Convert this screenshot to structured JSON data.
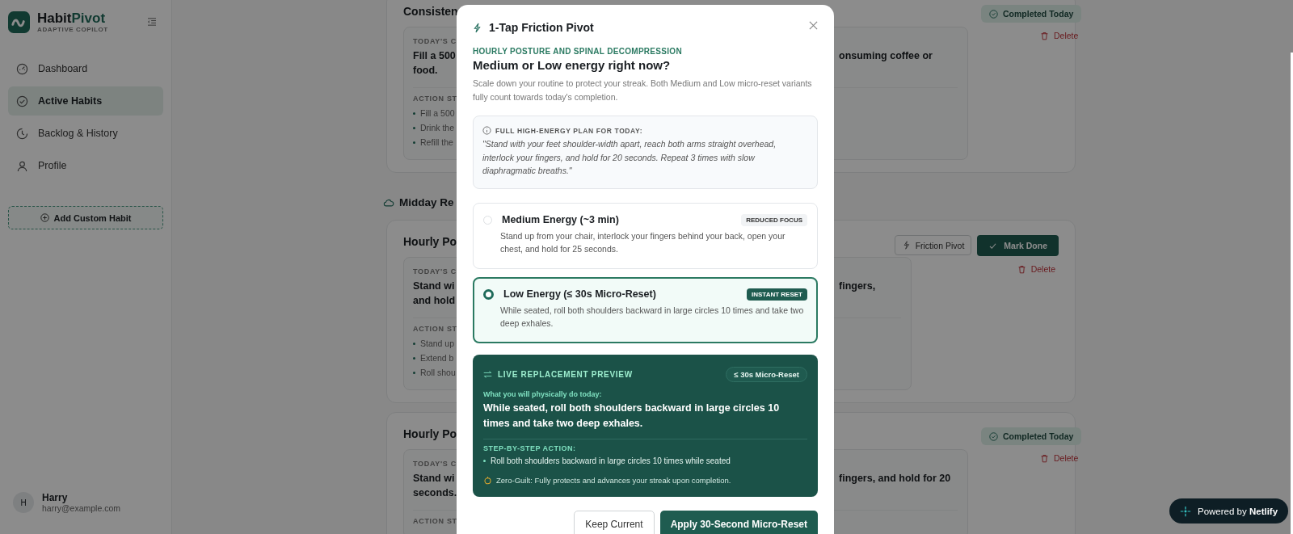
{
  "sidebar": {
    "brand_part_1": "Habit",
    "brand_part_2": "Pivot",
    "tagline": "ADAPTIVE COPILOT",
    "nav": [
      {
        "label": "Dashboard",
        "kind": "gauge",
        "selected": false
      },
      {
        "label": "Active Habits",
        "kind": "check",
        "selected": true
      },
      {
        "label": "Backlog & History",
        "kind": "clock",
        "selected": false
      },
      {
        "label": "Profile",
        "kind": "user",
        "selected": false
      }
    ],
    "add_button": "Add Custom Habit",
    "user": {
      "initial": "H",
      "name": "Harry",
      "email": "harry@example.com"
    }
  },
  "sections": [
    {
      "cards": [
        {
          "title": "Consisten",
          "challenge_label": "TODAY'S C",
          "challenge_lines": [
            {
              "left": "Fill a 500",
              "right": "onsuming coffee or"
            },
            {
              "left": "food."
            }
          ],
          "steps_label": "ACTION ST",
          "steps": [
            "Fill a 500",
            "Drink the",
            "Refill the"
          ],
          "completed": true,
          "status_text": "Completed Today",
          "delete": "Delete"
        }
      ]
    },
    {
      "heading": "Midday Re",
      "cards": [
        {
          "title": "Hourly Po",
          "challenge_label": "TODAY'S C",
          "challenge_lines": [
            {
              "left": "Stand wi",
              "right": "fingers,"
            },
            {
              "left": "and hold"
            }
          ],
          "steps_label": "ACTION ST",
          "steps": [
            "Stand up",
            "Extend b",
            "Roll shou"
          ],
          "completed": false,
          "pivot_button": "Friction Pivot",
          "done_button": "Mark Done",
          "delete": "Delete"
        },
        {
          "title": "Hourly Po",
          "challenge_label": "TODAY'S C",
          "challenge_lines": [
            {
              "left": "Stand wi",
              "right": "fingers, and hold for 20"
            },
            {
              "left": "seconds."
            }
          ],
          "steps_label": "ACTION ST",
          "completed": true,
          "status_text": "Completed Today",
          "delete": "Delete"
        }
      ]
    }
  ],
  "modal": {
    "title": "1-Tap Friction Pivot",
    "habit": "HOURLY POSTURE AND SPINAL DECOMPRESSION",
    "question": "Medium or Low energy right now?",
    "description": "Scale down your routine to protect your streak. Both Medium and Low micro-reset variants fully count towards today's completion.",
    "plan": {
      "label": "FULL HIGH-ENERGY PLAN FOR TODAY:",
      "text": "\"Stand with your feet shoulder-width apart, reach both arms straight overhead, interlock your fingers, and hold for 20 seconds. Repeat 3 times with slow diaphragmatic breaths.\""
    },
    "options": [
      {
        "title": "Medium Energy (~3 min)",
        "tag": "REDUCED FOCUS",
        "text": "Stand up from your chair, interlock your fingers behind your back, open your chest, and hold for 25 seconds.",
        "selected": false
      },
      {
        "title": "Low Energy (≤ 30s Micro-Reset)",
        "tag": "INSTANT RESET",
        "text": "While seated, roll both shoulders backward in large circles 10 times and take two deep exhales.",
        "selected": true
      }
    ],
    "preview": {
      "label": "LIVE REPLACEMENT PREVIEW",
      "badge": "≤ 30s Micro-Reset",
      "intro": "What you will physically do today:",
      "action": "While seated, roll both shoulders backward in large circles 10 times and take two deep exhales.",
      "steps_label": "STEP-BY-STEP ACTION:",
      "steps": [
        "Roll both shoulders backward in large circles 10 times while seated"
      ],
      "note": "Zero-Guilt: Fully protects and advances your streak upon completion."
    },
    "cancel_button": "Keep Current",
    "apply_button": "Apply 30-Second Micro-Reset"
  },
  "netlify_badge": "Powered by **Netlify**"
}
